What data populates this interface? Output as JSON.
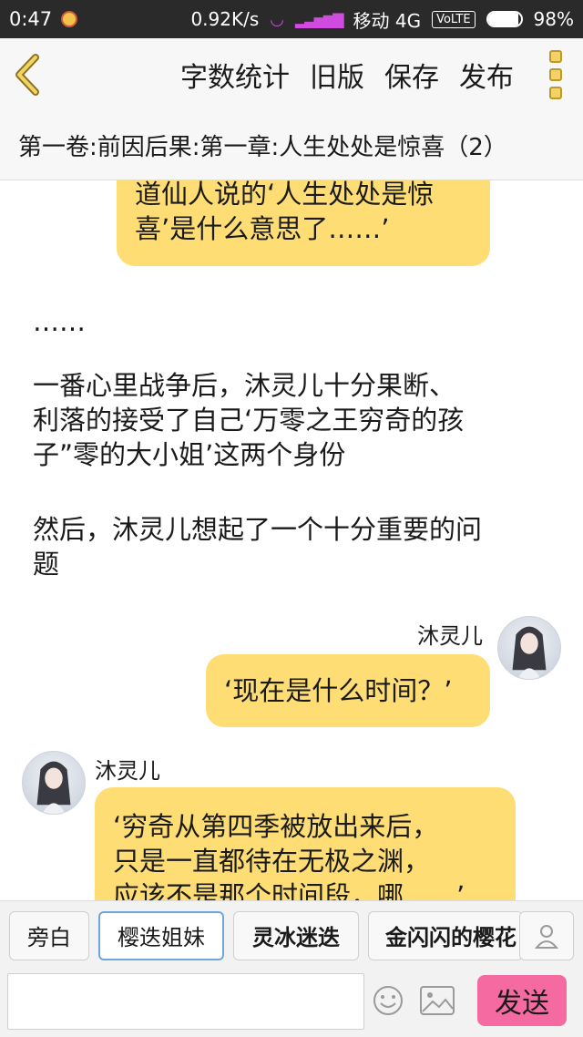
{
  "status_bar": {
    "time": "0:47",
    "speed": "0.92K/s",
    "carrier": "移动 4G",
    "volte": "VoLTE",
    "battery": "98%"
  },
  "toolbar": {
    "word_count": "字数统计",
    "old_version": "旧版",
    "save": "保存",
    "publish": "发布"
  },
  "chapter_title": "第一卷:前因后果:第一章:人生处处是惊喜（2）",
  "messages": {
    "bubble_top": {
      "line1": "道仙人说的‘人生处处是惊",
      "line2": "喜’是什么意思了……’"
    },
    "narration1": "……",
    "narration2": {
      "line1": "一番心里战争后，沐灵儿十分果断、",
      "line2": "利落的接受了自己‘万零之王穷奇的孩",
      "line3": "子”零的大小姐’这两个身份"
    },
    "narration3": {
      "line1": "然后，沐灵儿想起了一个十分重要的问",
      "line2": "题"
    },
    "right_message": {
      "speaker": "沐灵儿",
      "text": "‘现在是什么时间？’"
    },
    "left_message": {
      "speaker": "沐灵儿",
      "line1": "‘穷奇从第四季被放出来后，",
      "line2": "只是一直都待在无极之渊，",
      "line3": "应该不是那个时间段，哪……’"
    }
  },
  "roles": [
    "旁白",
    "樱迭姐妹",
    "灵冰迷迭",
    "金闪闪的樱花"
  ],
  "input": {
    "value": "",
    "send_label": "发送"
  },
  "colors": {
    "bubble": "#fedd74",
    "send_button": "#f56aa0",
    "selected_chip_border": "#6fa6d9"
  }
}
